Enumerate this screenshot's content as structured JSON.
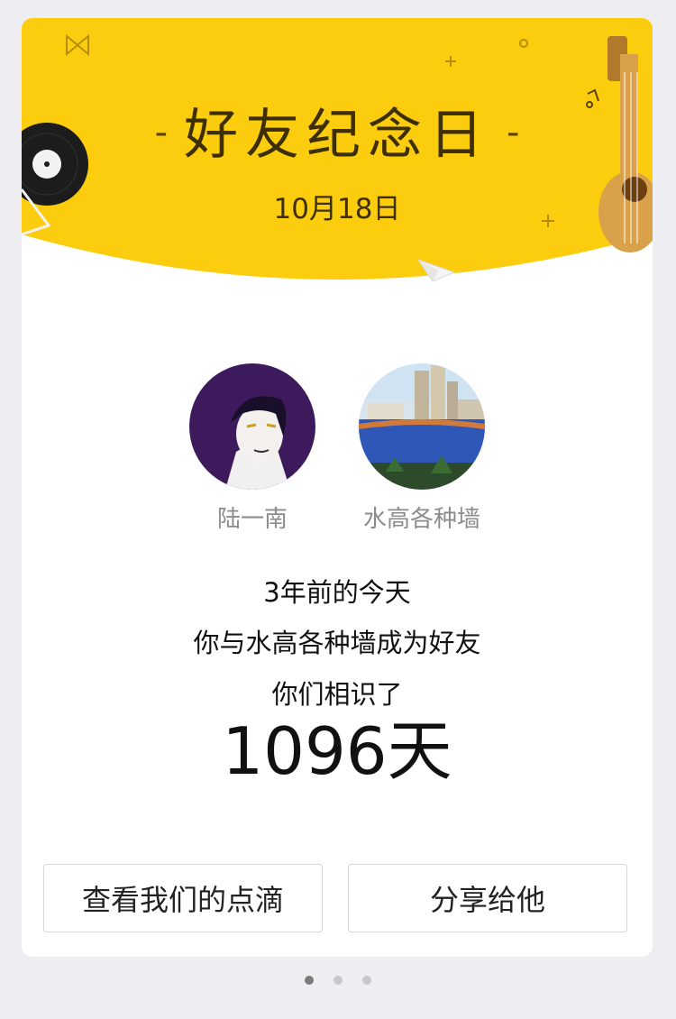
{
  "banner": {
    "title": "好友纪念日",
    "dash_left": "-",
    "dash_right": "-",
    "date": "10月18日",
    "color": "#fccd0e"
  },
  "friends": [
    {
      "name": "陆一南",
      "avatar": "anime-boy-avatar"
    },
    {
      "name": "水高各种墙",
      "avatar": "campus-track-avatar"
    }
  ],
  "message": {
    "line1": "3年前的今天",
    "line2": "你与水高各种墙成为好友",
    "line3": "你们相识了",
    "days": "1096天"
  },
  "buttons": {
    "view_moments": "查看我们的点滴",
    "share": "分享给他"
  },
  "pagination": {
    "total": 3,
    "active": 1
  }
}
